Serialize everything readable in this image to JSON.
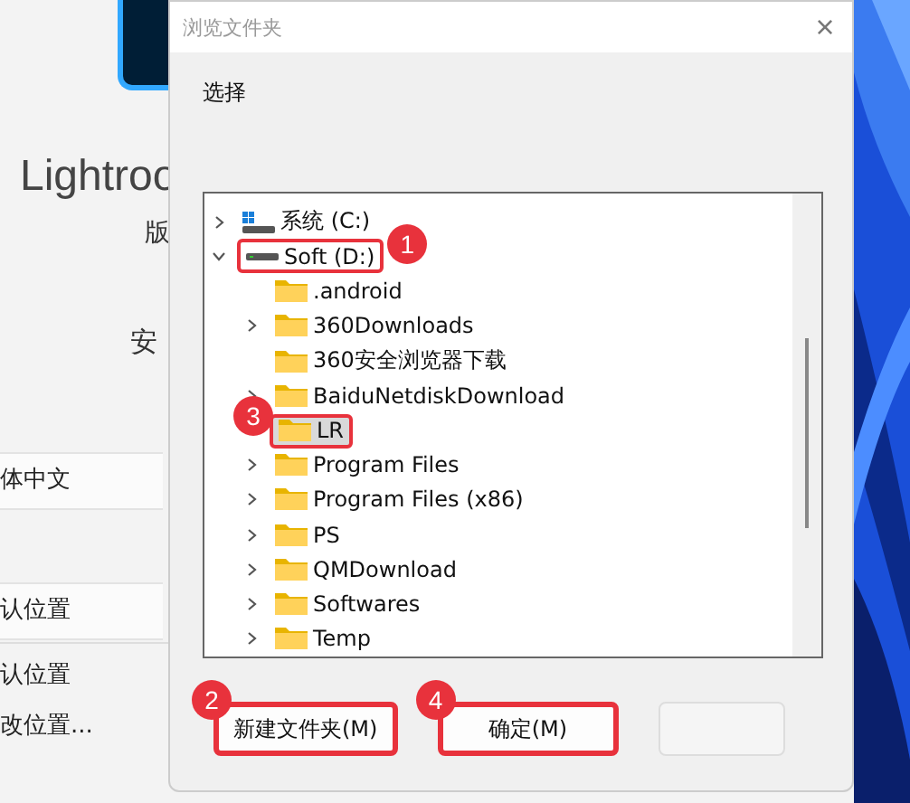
{
  "background_app": {
    "title": "Lightroo",
    "subtitle": "版",
    "section": "安",
    "fields": [
      {
        "value": "体中文"
      },
      {
        "value": "认位置"
      }
    ],
    "links": [
      "认位置",
      "改位置..."
    ]
  },
  "dialog": {
    "title": "浏览文件夹",
    "prompt": "选择",
    "close": "×",
    "tree": [
      {
        "label": "系统 (C:)",
        "kind": "system-drive",
        "expandable": true,
        "expanded": false,
        "selected": false
      },
      {
        "label": "Soft (D:)",
        "kind": "drive",
        "expandable": true,
        "expanded": true,
        "selected": false,
        "callout": "1",
        "callout_before": false,
        "children": [
          {
            "label": ".android",
            "kind": "folder",
            "expandable": false,
            "expanded": false,
            "selected": false
          },
          {
            "label": "360Downloads",
            "kind": "folder",
            "expandable": true,
            "expanded": false,
            "selected": false
          },
          {
            "label": "360安全浏览器下载",
            "kind": "folder",
            "expandable": false,
            "expanded": false,
            "selected": false
          },
          {
            "label": "BaiduNetdiskDownload",
            "kind": "folder",
            "expandable": true,
            "expanded": false,
            "selected": false
          },
          {
            "label": "LR",
            "kind": "folder",
            "expandable": false,
            "expanded": false,
            "selected": true,
            "callout": "3",
            "callout_before": true
          },
          {
            "label": "Program Files",
            "kind": "folder",
            "expandable": true,
            "expanded": false,
            "selected": false
          },
          {
            "label": "Program Files (x86)",
            "kind": "folder",
            "expandable": true,
            "expanded": false,
            "selected": false
          },
          {
            "label": "PS",
            "kind": "folder",
            "expandable": true,
            "expanded": false,
            "selected": false
          },
          {
            "label": "QMDownload",
            "kind": "folder",
            "expandable": true,
            "expanded": false,
            "selected": false
          },
          {
            "label": "Softwares",
            "kind": "folder",
            "expandable": true,
            "expanded": false,
            "selected": false
          },
          {
            "label": "Temp",
            "kind": "folder",
            "expandable": true,
            "expanded": false,
            "selected": false
          }
        ]
      }
    ],
    "buttons": [
      {
        "label": "新建文件夹(M)",
        "callout": "2",
        "disabled": false
      },
      {
        "label": "确定(M)",
        "callout": "4",
        "disabled": false
      },
      {
        "disabled": true
      }
    ]
  }
}
